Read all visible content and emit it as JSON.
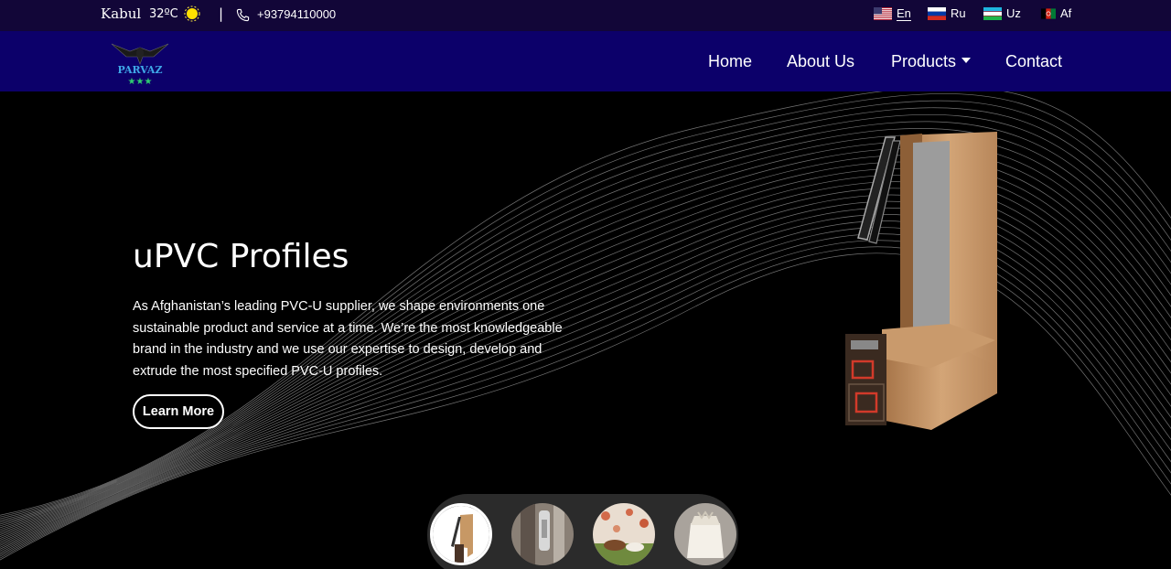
{
  "topbar": {
    "city": "Kabul",
    "temperature": "32ºC",
    "separator": "|",
    "phone": "+93794110000",
    "languages": [
      {
        "code": "En",
        "icon": "us-flag-icon",
        "active": true
      },
      {
        "code": "Ru",
        "icon": "russia-flag-icon",
        "active": false
      },
      {
        "code": "Uz",
        "icon": "uzbekistan-flag-icon",
        "active": false
      },
      {
        "code": "Af",
        "icon": "afghanistan-flag-icon",
        "active": false
      }
    ]
  },
  "navbar": {
    "logo_text": "PARVAZ",
    "items": [
      {
        "label": "Home"
      },
      {
        "label": "About Us"
      },
      {
        "label": "Products",
        "dropdown": true
      },
      {
        "label": "Contact"
      }
    ]
  },
  "hero": {
    "title": "uPVC Profiles",
    "description": "As Afghanistan’s leading PVC-U supplier, we shape environments one sustainable product and service at a time. We’re the most knowledgeable brand in the industry and we use our expertise to design, develop and extrude the most specified PVC-U profiles.",
    "button_label": "Learn More"
  },
  "thumbnails": [
    {
      "icon": "upvc-profile-thumbnail",
      "active": true
    },
    {
      "icon": "window-hardware-thumbnail",
      "active": false
    },
    {
      "icon": "cattle-field-thumbnail",
      "active": false
    },
    {
      "icon": "sack-bag-thumbnail",
      "active": false
    }
  ],
  "colors": {
    "topbar_bg": "#120638",
    "navbar_bg": "#0c006a",
    "hero_bg": "#000000"
  }
}
